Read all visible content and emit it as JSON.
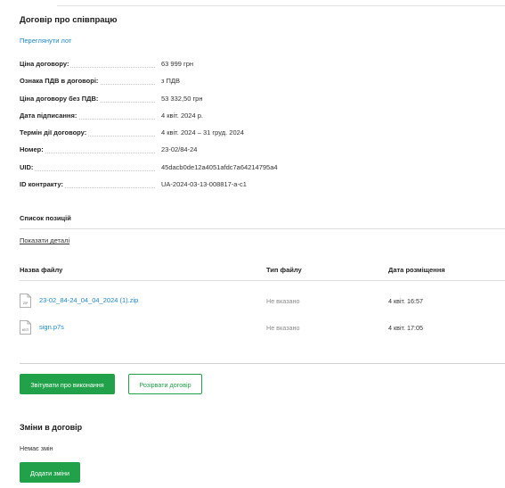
{
  "contract": {
    "title": "Договір про співпрацю",
    "view_lot_link": "Переглянути лот",
    "fields": [
      {
        "label": "Ціна договору:",
        "value": "63 999 грн"
      },
      {
        "label": "Ознака ПДВ в договорі:",
        "value": "з ПДВ"
      },
      {
        "label": "Ціна договору без ПДВ:",
        "value": "53 332,50 грн"
      },
      {
        "label": "Дата підписання:",
        "value": "4 квіт. 2024 р."
      },
      {
        "label": "Термін дії договору:",
        "value": "4 квіт. 2024 – 31 груд. 2024"
      },
      {
        "label": "Номер:",
        "value": "23-02/84-24"
      },
      {
        "label": "UID:",
        "value": "45dacb0de12a4051afdc7a64214795a4"
      },
      {
        "label": "ID контракту:",
        "value": "UA-2024-03-13-008817-a-c1"
      }
    ]
  },
  "positions": {
    "heading": "Список позицій",
    "show_details": "Показати деталі"
  },
  "files": {
    "columns": [
      "Назва файлу",
      "Тип файлу",
      "Дата розміщення"
    ],
    "rows": [
      {
        "icon": "zip-file-icon",
        "icon_label": "ZIP",
        "name": "23-02_84-24_04_04_2024 (1).zip",
        "type": "Не вказано",
        "date": "4 квіт. 16:57"
      },
      {
        "icon": "signature-file-icon",
        "icon_label": "КЕП",
        "name": "sign.p7s",
        "type": "Не вказано",
        "date": "4 квіт. 17:05"
      }
    ]
  },
  "actions": {
    "report_button": "Звітувати про виконання",
    "terminate_button": "Розірвати договір"
  },
  "changes": {
    "title": "Зміни в договір",
    "empty_text": "Немає змін",
    "add_button": "Додати зміни"
  },
  "colors": {
    "accent_green": "#21a24a",
    "link_blue": "#1e88c9"
  }
}
